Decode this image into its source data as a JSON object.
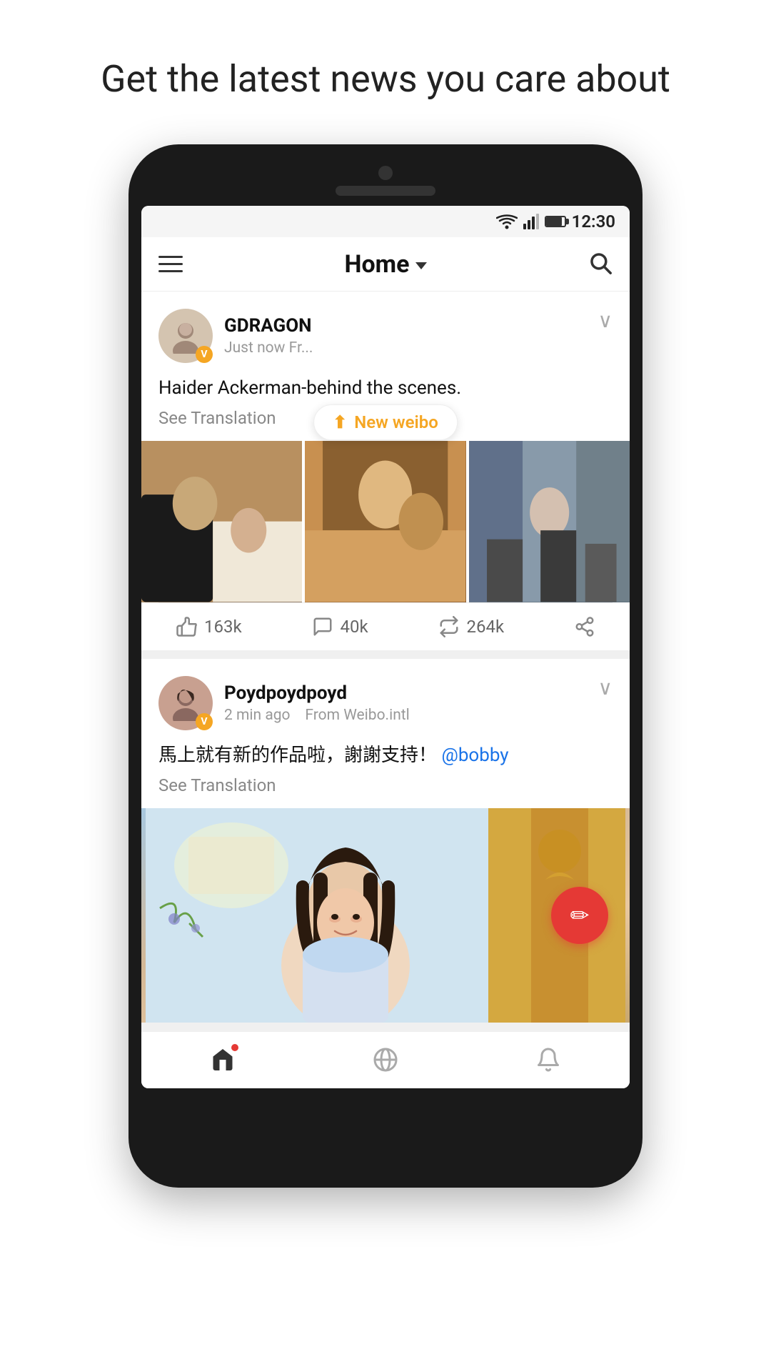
{
  "page": {
    "headline": "Get the latest news you care about"
  },
  "status_bar": {
    "time": "12:30"
  },
  "header": {
    "title": "Home",
    "menu_label": "Menu",
    "search_label": "Search"
  },
  "new_weibo_pill": {
    "label": "New weibo"
  },
  "posts": [
    {
      "id": "post1",
      "username": "GDRAGON",
      "meta": "Just now  Fr...",
      "text": "Haider Ackerman-behind the scenes.",
      "see_translation": "See Translation",
      "like_count": "163k",
      "comment_count": "40k",
      "repost_count": "264k",
      "has_photo_grid": true,
      "avatar_emoji": "👤"
    },
    {
      "id": "post2",
      "username": "Poydpoydpoyd",
      "meta": "2 min ago",
      "meta2": "From Weibo.intl",
      "text": "馬上就有新的作品啦，謝謝支持！",
      "mention": "@bobby",
      "see_translation": "See Translation",
      "has_big_photo": true,
      "avatar_emoji": "👤"
    }
  ],
  "bottom_nav": {
    "home_label": "Home",
    "discover_label": "Discover",
    "notifications_label": "Notifications"
  },
  "fab": {
    "label": "Compose"
  }
}
